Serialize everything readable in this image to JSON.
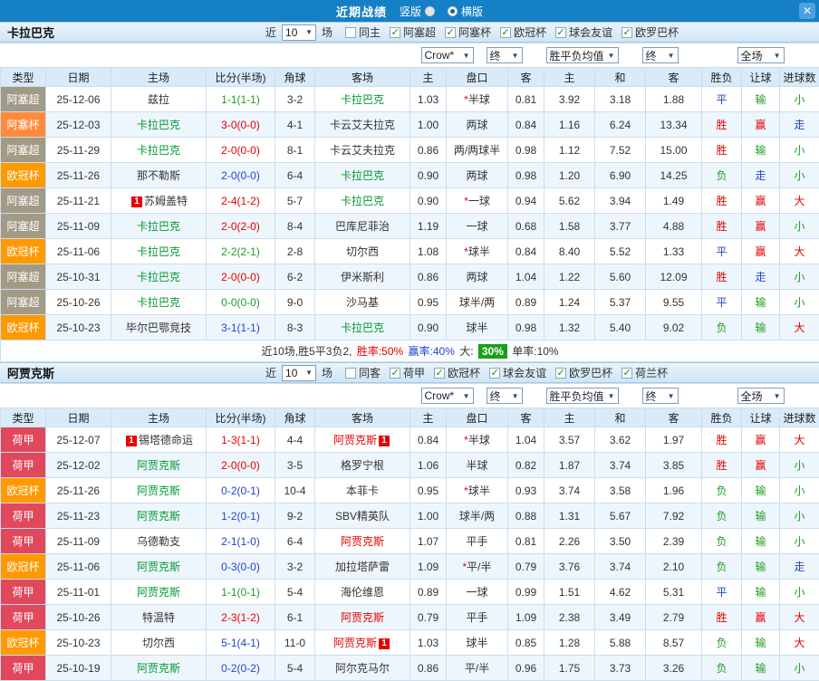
{
  "topbar": {
    "title": "近期战绩",
    "close_glyph": "✕",
    "radios": [
      {
        "label": "竖版",
        "selected": false
      },
      {
        "label": "横版",
        "selected": true
      }
    ]
  },
  "columns": [
    "类型",
    "日期",
    "主场",
    "比分(半场)",
    "角球",
    "客场",
    "主",
    "盘口",
    "客",
    "主",
    "和",
    "客",
    "胜负",
    "让球",
    "进球数"
  ],
  "color_maps": {
    "league": {
      "阿塞超": "#A39A86",
      "阿塞杯": "#FF8A3C",
      "欧冠杯": "#FF9900",
      "荷甲": "#E2485C"
    },
    "team": {
      "green": "#009933",
      "red": "#E60000",
      "black": "#333333"
    },
    "score_by_result": {
      "胜": "#E60000",
      "平": "#1E9E1E",
      "负": "#2244CC"
    },
    "result": {
      "胜": "#E60000",
      "平": "#2244CC",
      "负": "#1E9E1E"
    },
    "handicap_result": {
      "赢": "#E60000",
      "输": "#1E9E1E",
      "走": "#2244CC"
    },
    "goals": {
      "大": "#E60000",
      "小": "#1E9E1E",
      "走": "#2244CC"
    },
    "star": "#E60000"
  },
  "sections": [
    {
      "team": "卡拉巴克",
      "near_label": "近",
      "count": "10",
      "matches_label": "场",
      "checkboxes": [
        {
          "label": "同主",
          "checked": false
        },
        {
          "label": "阿塞超",
          "checked": true
        },
        {
          "label": "阿塞杯",
          "checked": true
        },
        {
          "label": "欧冠杯",
          "checked": true
        },
        {
          "label": "球会友谊",
          "checked": true
        },
        {
          "label": "欧罗巴杯",
          "checked": true
        }
      ],
      "filters": {
        "bookmaker": "Crow*",
        "final_a": "终",
        "mean": "胜平负均值",
        "final_b": "终",
        "scope": "全场"
      },
      "rows": [
        {
          "league": "阿塞超",
          "date": "25-12-06",
          "home": {
            "name": "兹拉",
            "color": "black"
          },
          "score": "1-1(1-1)",
          "corner": "3-2",
          "away": {
            "name": "卡拉巴克",
            "color": "green"
          },
          "odds": [
            "1.03",
            "*半球",
            "0.81"
          ],
          "mean": [
            "3.92",
            "3.18",
            "1.88"
          ],
          "result": "平",
          "handicap_result": "输",
          "goals": "小"
        },
        {
          "league": "阿塞杯",
          "date": "25-12-03",
          "home": {
            "name": "卡拉巴克",
            "color": "green"
          },
          "score": "3-0(0-0)",
          "corner": "4-1",
          "away": {
            "name": "卡云艾夫拉克",
            "color": "black"
          },
          "odds": [
            "1.00",
            "两球",
            "0.84"
          ],
          "mean": [
            "1.16",
            "6.24",
            "13.34"
          ],
          "result": "胜",
          "handicap_result": "赢",
          "goals": "走"
        },
        {
          "league": "阿塞超",
          "date": "25-11-29",
          "home": {
            "name": "卡拉巴克",
            "color": "green"
          },
          "score": "2-0(0-0)",
          "corner": "8-1",
          "away": {
            "name": "卡云艾夫拉克",
            "color": "black"
          },
          "odds": [
            "0.86",
            "两/两球半",
            "0.98"
          ],
          "mean": [
            "1.12",
            "7.52",
            "15.00"
          ],
          "result": "胜",
          "handicap_result": "输",
          "goals": "小"
        },
        {
          "league": "欧冠杯",
          "date": "25-11-26",
          "home": {
            "name": "那不勒斯",
            "color": "black"
          },
          "score": "2-0(0-0)",
          "corner": "6-4",
          "away": {
            "name": "卡拉巴克",
            "color": "green"
          },
          "odds": [
            "0.90",
            "两球",
            "0.98"
          ],
          "mean": [
            "1.20",
            "6.90",
            "14.25"
          ],
          "result": "负",
          "handicap_result": "走",
          "goals": "小"
        },
        {
          "league": "阿塞超",
          "date": "25-11-21",
          "home": {
            "name": "苏姆盖特",
            "color": "black",
            "badge": "1",
            "badge_pos": "before"
          },
          "score": "2-4(1-2)",
          "corner": "5-7",
          "away": {
            "name": "卡拉巴克",
            "color": "green"
          },
          "odds": [
            "0.90",
            "*一球",
            "0.94"
          ],
          "mean": [
            "5.62",
            "3.94",
            "1.49"
          ],
          "result": "胜",
          "handicap_result": "赢",
          "goals": "大"
        },
        {
          "league": "阿塞超",
          "date": "25-11-09",
          "home": {
            "name": "卡拉巴克",
            "color": "green"
          },
          "score": "2-0(2-0)",
          "corner": "8-4",
          "away": {
            "name": "巴库尼菲治",
            "color": "black"
          },
          "odds": [
            "1.19",
            "一球",
            "0.68"
          ],
          "mean": [
            "1.58",
            "3.77",
            "4.88"
          ],
          "result": "胜",
          "handicap_result": "赢",
          "goals": "小"
        },
        {
          "league": "欧冠杯",
          "date": "25-11-06",
          "home": {
            "name": "卡拉巴克",
            "color": "green"
          },
          "score": "2-2(2-1)",
          "corner": "2-8",
          "away": {
            "name": "切尔西",
            "color": "black"
          },
          "odds": [
            "1.08",
            "*球半",
            "0.84"
          ],
          "mean": [
            "8.40",
            "5.52",
            "1.33"
          ],
          "result": "平",
          "handicap_result": "赢",
          "goals": "大"
        },
        {
          "league": "阿塞超",
          "date": "25-10-31",
          "home": {
            "name": "卡拉巴克",
            "color": "green"
          },
          "score": "2-0(0-0)",
          "corner": "6-2",
          "away": {
            "name": "伊米斯利",
            "color": "black"
          },
          "odds": [
            "0.86",
            "两球",
            "1.04"
          ],
          "mean": [
            "1.22",
            "5.60",
            "12.09"
          ],
          "result": "胜",
          "handicap_result": "走",
          "goals": "小"
        },
        {
          "league": "阿塞超",
          "date": "25-10-26",
          "home": {
            "name": "卡拉巴克",
            "color": "green"
          },
          "score": "0-0(0-0)",
          "corner": "9-0",
          "away": {
            "name": "沙马基",
            "color": "black"
          },
          "odds": [
            "0.95",
            "球半/两",
            "0.89"
          ],
          "mean": [
            "1.24",
            "5.37",
            "9.55"
          ],
          "result": "平",
          "handicap_result": "输",
          "goals": "小"
        },
        {
          "league": "欧冠杯",
          "date": "25-10-23",
          "home": {
            "name": "毕尔巴鄂竞技",
            "color": "black"
          },
          "score": "3-1(1-1)",
          "corner": "8-3",
          "away": {
            "name": "卡拉巴克",
            "color": "green"
          },
          "odds": [
            "0.90",
            "球半",
            "0.98"
          ],
          "mean": [
            "1.32",
            "5.40",
            "9.02"
          ],
          "result": "负",
          "handicap_result": "输",
          "goals": "大"
        }
      ],
      "summary": {
        "parts": [
          {
            "text": "近10场,胜5平3负2, ",
            "color": "#333333"
          },
          {
            "text": "胜率:50%",
            "color": "#E60000"
          },
          {
            "text": " 赢率:40%",
            "color": "#2244CC"
          },
          {
            "text": " 大: ",
            "color": "#333333"
          },
          {
            "text": "30%",
            "color": "#FFFFFF",
            "bg": "#18A018"
          },
          {
            "text": " 单率:10%",
            "color": "#333333"
          }
        ]
      }
    },
    {
      "team": "阿贾克斯",
      "near_label": "近",
      "count": "10",
      "matches_label": "场",
      "checkboxes": [
        {
          "label": "同客",
          "checked": false
        },
        {
          "label": "荷甲",
          "checked": true
        },
        {
          "label": "欧冠杯",
          "checked": true
        },
        {
          "label": "球会友谊",
          "checked": true
        },
        {
          "label": "欧罗巴杯",
          "checked": true
        },
        {
          "label": "荷兰杯",
          "checked": true
        }
      ],
      "filters": {
        "bookmaker": "Crow*",
        "final_a": "终",
        "mean": "胜平负均值",
        "final_b": "终",
        "scope": "全场"
      },
      "rows": [
        {
          "league": "荷甲",
          "date": "25-12-07",
          "home": {
            "name": "锡塔德命运",
            "color": "black",
            "badge": "1",
            "badge_pos": "before"
          },
          "score": "1-3(1-1)",
          "corner": "4-4",
          "away": {
            "name": "阿贾克斯",
            "color": "red",
            "badge": "1",
            "badge_pos": "after"
          },
          "odds": [
            "0.84",
            "*半球",
            "1.04"
          ],
          "mean": [
            "3.57",
            "3.62",
            "1.97"
          ],
          "result": "胜",
          "handicap_result": "赢",
          "goals": "大"
        },
        {
          "league": "荷甲",
          "date": "25-12-02",
          "home": {
            "name": "阿贾克斯",
            "color": "green"
          },
          "score": "2-0(0-0)",
          "corner": "3-5",
          "away": {
            "name": "格罗宁根",
            "color": "black"
          },
          "odds": [
            "1.06",
            "半球",
            "0.82"
          ],
          "mean": [
            "1.87",
            "3.74",
            "3.85"
          ],
          "result": "胜",
          "handicap_result": "赢",
          "goals": "小"
        },
        {
          "league": "欧冠杯",
          "date": "25-11-26",
          "home": {
            "name": "阿贾克斯",
            "color": "green"
          },
          "score": "0-2(0-1)",
          "corner": "10-4",
          "away": {
            "name": "本菲卡",
            "color": "black"
          },
          "odds": [
            "0.95",
            "*球半",
            "0.93"
          ],
          "mean": [
            "3.74",
            "3.58",
            "1.96"
          ],
          "result": "负",
          "handicap_result": "输",
          "goals": "小"
        },
        {
          "league": "荷甲",
          "date": "25-11-23",
          "home": {
            "name": "阿贾克斯",
            "color": "green"
          },
          "score": "1-2(0-1)",
          "corner": "9-2",
          "away": {
            "name": "SBV精英队",
            "color": "black"
          },
          "odds": [
            "1.00",
            "球半/两",
            "0.88"
          ],
          "mean": [
            "1.31",
            "5.67",
            "7.92"
          ],
          "result": "负",
          "handicap_result": "输",
          "goals": "小"
        },
        {
          "league": "荷甲",
          "date": "25-11-09",
          "home": {
            "name": "乌德勒支",
            "color": "black"
          },
          "score": "2-1(1-0)",
          "corner": "6-4",
          "away": {
            "name": "阿贾克斯",
            "color": "red"
          },
          "odds": [
            "1.07",
            "平手",
            "0.81"
          ],
          "mean": [
            "2.26",
            "3.50",
            "2.39"
          ],
          "result": "负",
          "handicap_result": "输",
          "goals": "小"
        },
        {
          "league": "欧冠杯",
          "date": "25-11-06",
          "home": {
            "name": "阿贾克斯",
            "color": "green"
          },
          "score": "0-3(0-0)",
          "corner": "3-2",
          "away": {
            "name": "加拉塔萨雷",
            "color": "black"
          },
          "odds": [
            "1.09",
            "*平/半",
            "0.79"
          ],
          "mean": [
            "3.76",
            "3.74",
            "2.10"
          ],
          "result": "负",
          "handicap_result": "输",
          "goals": "走"
        },
        {
          "league": "荷甲",
          "date": "25-11-01",
          "home": {
            "name": "阿贾克斯",
            "color": "green"
          },
          "score": "1-1(0-1)",
          "corner": "5-4",
          "away": {
            "name": "海伦维恩",
            "color": "black"
          },
          "odds": [
            "0.89",
            "一球",
            "0.99"
          ],
          "mean": [
            "1.51",
            "4.62",
            "5.31"
          ],
          "result": "平",
          "handicap_result": "输",
          "goals": "小"
        },
        {
          "league": "荷甲",
          "date": "25-10-26",
          "home": {
            "name": "特温特",
            "color": "black"
          },
          "score": "2-3(1-2)",
          "corner": "6-1",
          "away": {
            "name": "阿贾克斯",
            "color": "red"
          },
          "odds": [
            "0.79",
            "平手",
            "1.09"
          ],
          "mean": [
            "2.38",
            "3.49",
            "2.79"
          ],
          "result": "胜",
          "handicap_result": "赢",
          "goals": "大"
        },
        {
          "league": "欧冠杯",
          "date": "25-10-23",
          "home": {
            "name": "切尔西",
            "color": "black"
          },
          "score": "5-1(4-1)",
          "corner": "11-0",
          "away": {
            "name": "阿贾克斯",
            "color": "red",
            "badge": "1",
            "badge_pos": "after"
          },
          "odds": [
            "1.03",
            "球半",
            "0.85"
          ],
          "mean": [
            "1.28",
            "5.88",
            "8.57"
          ],
          "result": "负",
          "handicap_result": "输",
          "goals": "大"
        },
        {
          "league": "荷甲",
          "date": "25-10-19",
          "home": {
            "name": "阿贾克斯",
            "color": "green"
          },
          "score": "0-2(0-2)",
          "corner": "5-4",
          "away": {
            "name": "阿尔克马尔",
            "color": "black"
          },
          "odds": [
            "0.86",
            "平/半",
            "0.96"
          ],
          "mean": [
            "1.75",
            "3.73",
            "3.26"
          ],
          "result": "负",
          "handicap_result": "输",
          "goals": "小"
        }
      ]
    }
  ]
}
